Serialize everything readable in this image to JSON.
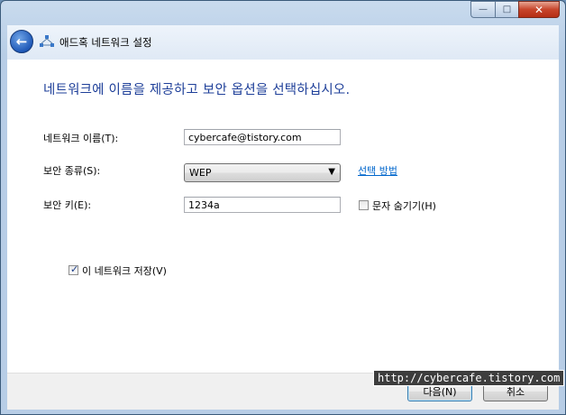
{
  "window": {
    "title": "애드혹 네트워크 설정",
    "caption_buttons": {
      "minimize": "—",
      "maximize": "□",
      "close": "✕"
    }
  },
  "header": {
    "back_icon": "back-arrow-icon",
    "network_icon": "network-icon"
  },
  "main": {
    "instruction": "네트워크에 이름을 제공하고 보안 옵션을 선택하십시오.",
    "network_name_label": "네트워크 이름(T):",
    "network_name_value": "cybercafe@tistory.com",
    "security_type_label": "보안 종류(S):",
    "security_type_value": "WEP",
    "help_link": "선택 방법",
    "security_key_label": "보안 키(E):",
    "security_key_value": "1234a",
    "hide_chars_label": "문자 숨기기(H)",
    "hide_chars_checked": false,
    "save_network_label": "이 네트워크 저장(V)",
    "save_network_checked": true
  },
  "footer": {
    "next_label": "다음(N)",
    "cancel_label": "취소"
  },
  "watermark": "http://cybercafe.tistory.com",
  "colors": {
    "instruction": "#1e3f99",
    "link": "#0066cc",
    "close_button": "#c7452b"
  }
}
